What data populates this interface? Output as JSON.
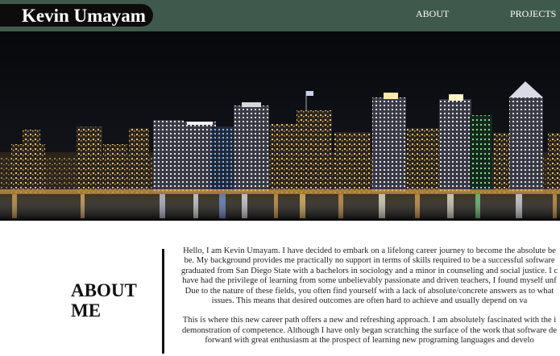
{
  "header": {
    "name": "Kevin Umayam",
    "nav": [
      {
        "label": "ABOUT"
      },
      {
        "label": "PROJECTS"
      }
    ]
  },
  "hero": {
    "image": "night-city-skyline-photo"
  },
  "about": {
    "heading_line1": "ABOUT",
    "heading_line2": "ME",
    "paragraph1": [
      "Hello, I am Kevin Umayam. I have decided to embark on a lifelong career journey to become the absolute be",
      "be. My background provides me practically no support in terms of skills required to be a successful software",
      "graduated from San Diego State with a bachelors in sociology and a minor in counseling and social justice. I c",
      "have had the privilege of learning from some unbelievably passionate and driven teachers, I found myself unf",
      "Due to the nature of these fields, you often find yourself with a lack of absolute/concrete answers as to what",
      "issues. This means that desired outcomes are often hard to achieve and usually depend on va"
    ],
    "paragraph2": [
      "This is where this new career path offers a new and refreshing approach. I am absolutely fascinated with the i",
      "demonstration of competence. Although I have only began scratching the surface of the work that software de",
      "forward with great enthusiasm at the prospect of learning new programing languages and develo"
    ]
  },
  "colors": {
    "topbar": "#3f5a4c",
    "brand_pill": "#0c0c0c"
  }
}
